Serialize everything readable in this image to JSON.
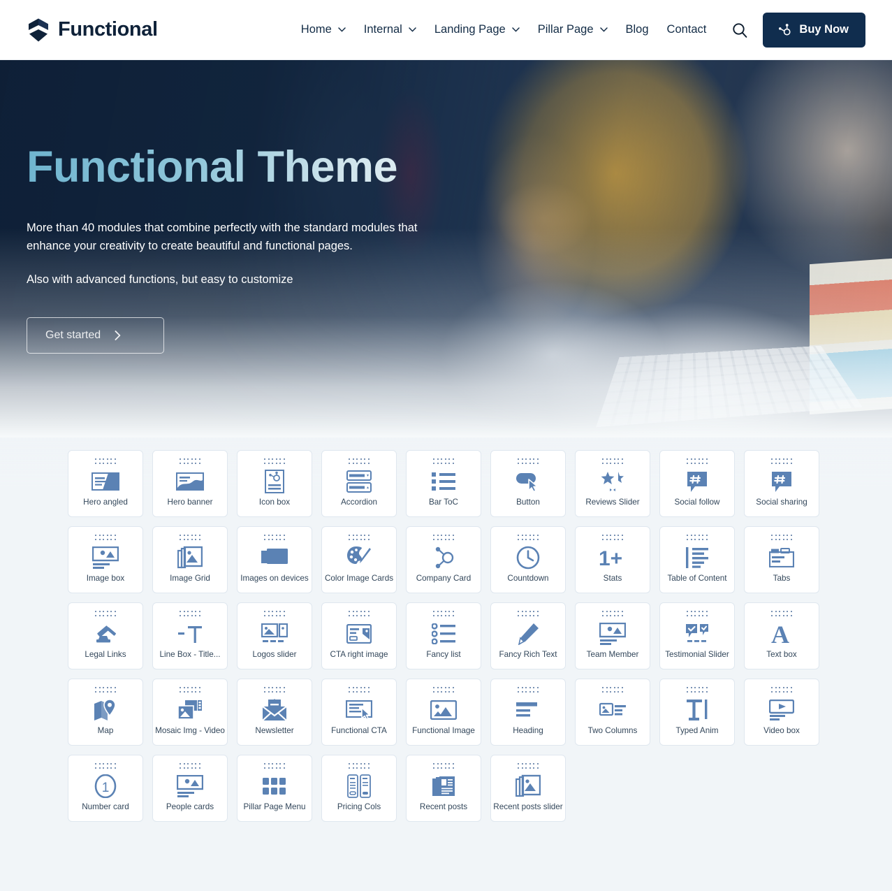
{
  "header": {
    "brand": "Functional",
    "nav": [
      {
        "label": "Home",
        "has_dropdown": true
      },
      {
        "label": "Internal",
        "has_dropdown": true
      },
      {
        "label": "Landing Page",
        "has_dropdown": true
      },
      {
        "label": "Pillar Page",
        "has_dropdown": true
      },
      {
        "label": "Blog",
        "has_dropdown": false
      },
      {
        "label": "Contact",
        "has_dropdown": false
      }
    ],
    "search_icon": "search-icon",
    "buy_label": "Buy Now",
    "buy_icon": "hubspot-sprocket-icon",
    "buy_bg": "#102d4e"
  },
  "hero": {
    "title": "Functional Theme",
    "paragraph": "More than 40 modules that combine perfectly with the standard modules that enhance your creativity to create beautiful and functional pages.",
    "paragraph2": "Also with advanced functions, but easy to customize",
    "cta_label": "Get started",
    "cta_icon": "chevron-right-icon",
    "title_color": "#8fc6da",
    "bg_color": "#14283f"
  },
  "modules": [
    {
      "label": "Hero angled",
      "icon": "hero-angled-icon"
    },
    {
      "label": "Hero banner",
      "icon": "hero-banner-icon"
    },
    {
      "label": "Icon box",
      "icon": "icon-box-icon"
    },
    {
      "label": "Accordion",
      "icon": "accordion-icon"
    },
    {
      "label": "Bar ToC",
      "icon": "bar-toc-icon"
    },
    {
      "label": "Button",
      "icon": "button-cursor-icon"
    },
    {
      "label": "Reviews Slider",
      "icon": "stars-slider-icon"
    },
    {
      "label": "Social follow",
      "icon": "social-follow-icon"
    },
    {
      "label": "Social sharing",
      "icon": "social-sharing-icon"
    },
    {
      "label": "Image box",
      "icon": "image-box-icon"
    },
    {
      "label": "Image Grid",
      "icon": "image-grid-icon"
    },
    {
      "label": "Images on devices",
      "icon": "images-on-devices-icon"
    },
    {
      "label": "Color Image Cards",
      "icon": "palette-icon"
    },
    {
      "label": "Company Card",
      "icon": "company-card-icon"
    },
    {
      "label": "Countdown",
      "icon": "clock-icon"
    },
    {
      "label": "Stats",
      "icon": "one-plus-icon"
    },
    {
      "label": "Table of Content",
      "icon": "table-of-content-icon"
    },
    {
      "label": "Tabs",
      "icon": "tabs-icon"
    },
    {
      "label": "Legal Links",
      "icon": "gavel-icon"
    },
    {
      "label": "Line Box - Title...",
      "icon": "line-box-title-icon",
      "truncated": true
    },
    {
      "label": "Logos slider",
      "icon": "logos-slider-icon"
    },
    {
      "label": "CTA right image",
      "icon": "cta-right-image-icon"
    },
    {
      "label": "Fancy list",
      "icon": "fancy-list-icon"
    },
    {
      "label": "Fancy Rich Text",
      "icon": "pencil-icon"
    },
    {
      "label": "Team Member",
      "icon": "team-member-icon"
    },
    {
      "label": "Testimonial Slider",
      "icon": "testimonial-slider-icon"
    },
    {
      "label": "Text box",
      "icon": "letter-a-icon"
    },
    {
      "label": "Map",
      "icon": "map-pin-icon"
    },
    {
      "label": "Mosaic Img - Video",
      "icon": "mosaic-img-video-icon"
    },
    {
      "label": "Newsletter",
      "icon": "envelope-icon"
    },
    {
      "label": "Functional CTA",
      "icon": "functional-cta-icon"
    },
    {
      "label": "Functional Image",
      "icon": "functional-image-icon"
    },
    {
      "label": "Heading",
      "icon": "heading-icon"
    },
    {
      "label": "Two Columns",
      "icon": "two-columns-icon"
    },
    {
      "label": "Typed Anim",
      "icon": "typed-anim-icon"
    },
    {
      "label": "Video box",
      "icon": "video-box-icon"
    },
    {
      "label": "Number card",
      "icon": "number-one-circle-icon"
    },
    {
      "label": "People cards",
      "icon": "people-cards-icon"
    },
    {
      "label": "Pillar Page Menu",
      "icon": "grid-dots-icon"
    },
    {
      "label": "Pricing Cols",
      "icon": "pricing-cols-icon"
    },
    {
      "label": "Recent posts",
      "icon": "newspaper-icon"
    },
    {
      "label": "Recent posts slider",
      "icon": "recent-posts-slider-icon"
    }
  ]
}
